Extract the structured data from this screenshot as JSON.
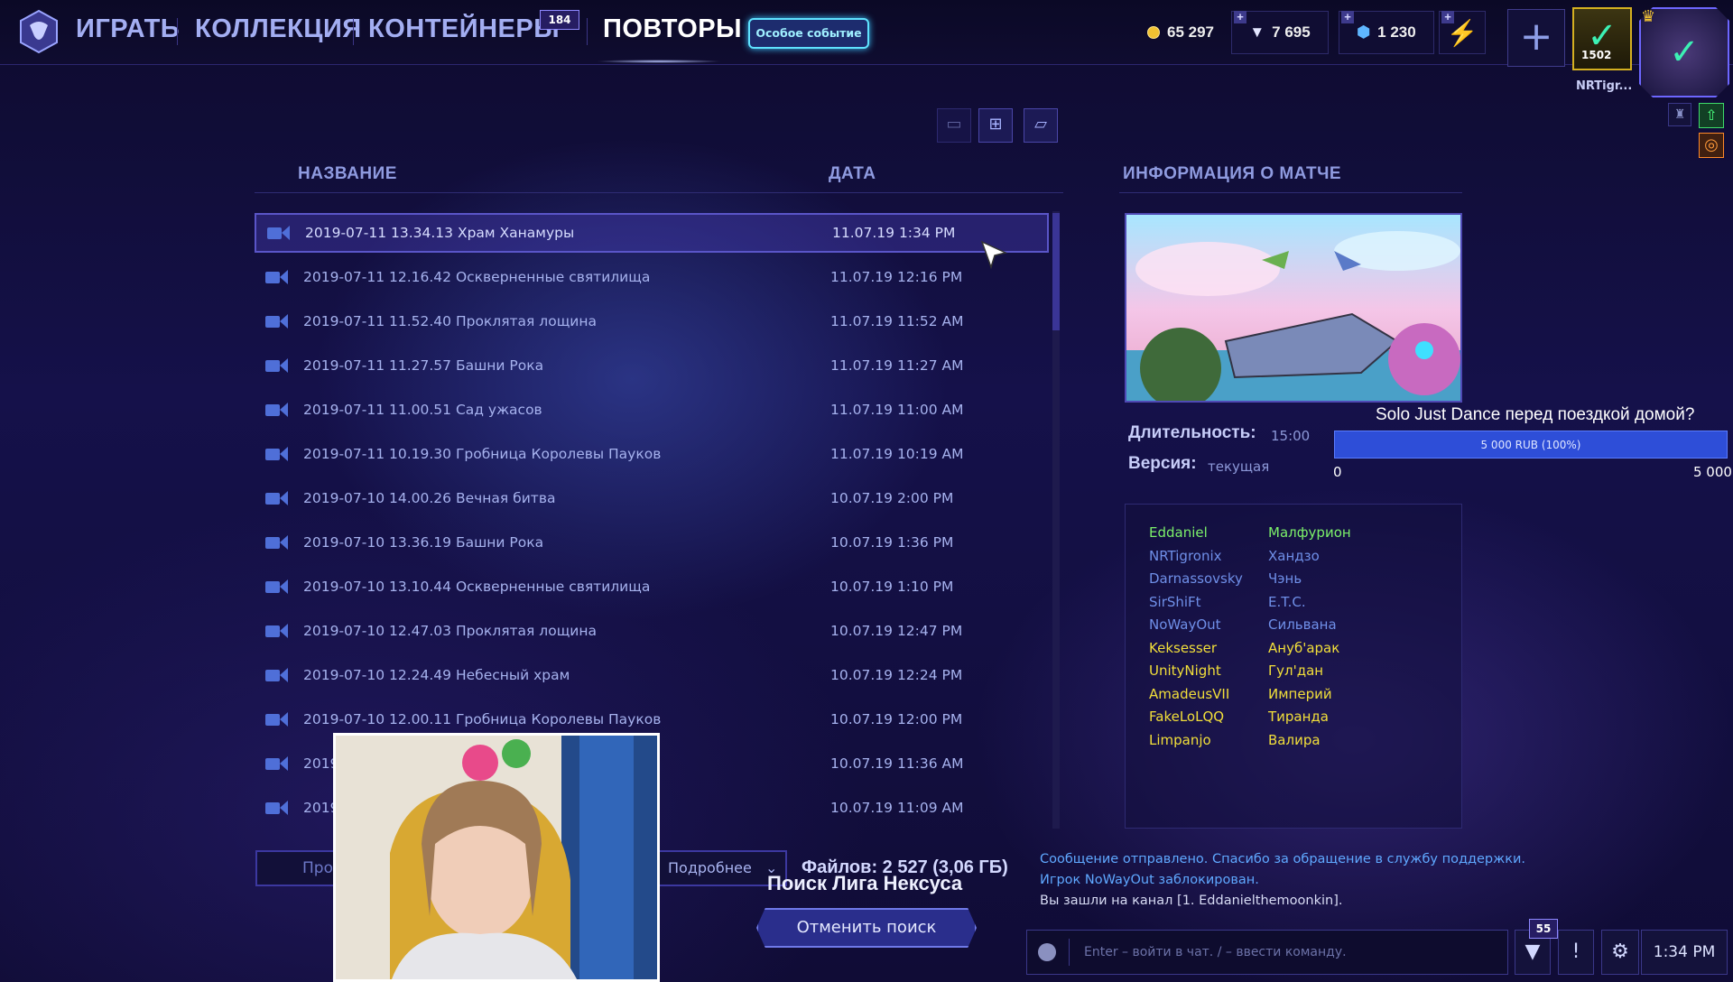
{
  "nav": {
    "play": "ИГРАТЬ",
    "collection": "КОЛЛЕКЦИЯ",
    "containers": "КОНТЕЙНЕРЫ",
    "containers_badge": "184",
    "replays": "ПОВТОРЫ",
    "event": "Особое событие"
  },
  "currency": {
    "gold": "65 297",
    "shards": "7 695",
    "gems": "1 230"
  },
  "profile": {
    "level": "1502",
    "name": "NRTigr..."
  },
  "list": {
    "col_name": "НАЗВАНИЕ",
    "col_date": "ДАТА",
    "rows": [
      {
        "name": "2019-07-11 13.34.13 Храм Ханамуры",
        "date": "11.07.19 1:34 PM"
      },
      {
        "name": "2019-07-11 12.16.42 Оскверненные святилища",
        "date": "11.07.19 12:16 PM"
      },
      {
        "name": "2019-07-11 11.52.40 Проклятая лощина",
        "date": "11.07.19 11:52 AM"
      },
      {
        "name": "2019-07-11 11.27.57 Башни Рока",
        "date": "11.07.19 11:27 AM"
      },
      {
        "name": "2019-07-11 11.00.51 Сад ужасов",
        "date": "11.07.19 11:00 AM"
      },
      {
        "name": "2019-07-11 10.19.30 Гробница Королевы Пауков",
        "date": "11.07.19 10:19 AM"
      },
      {
        "name": "2019-07-10 14.00.26 Вечная битва",
        "date": "10.07.19 2:00 PM"
      },
      {
        "name": "2019-07-10 13.36.19 Башни Рока",
        "date": "10.07.19 1:36 PM"
      },
      {
        "name": "2019-07-10 13.10.44 Оскверненные святилища",
        "date": "10.07.19 1:10 PM"
      },
      {
        "name": "2019-07-10 12.47.03 Проклятая лощина",
        "date": "10.07.19 12:47 PM"
      },
      {
        "name": "2019-07-10 12.24.49 Небесный храм",
        "date": "10.07.19 12:24 PM"
      },
      {
        "name": "2019-07-10 12.00.11 Гробница Королевы Пауков",
        "date": "10.07.19 12:00 PM"
      },
      {
        "name": "2019",
        "date": "10.07.19 11:36 AM"
      },
      {
        "name": "2019",
        "date": "10.07.19 11:09 AM"
      }
    ]
  },
  "match": {
    "header": "ИНФОРМАЦИЯ О МАТЧЕ",
    "duration_label": "Длительность:",
    "duration": "15:00",
    "version_label": "Версия:",
    "version": "текущая",
    "players": [
      {
        "player": "Eddaniel",
        "hero": "Малфурион",
        "color": "#7cf06a"
      },
      {
        "player": "NRTigronix",
        "hero": "Хандзо",
        "color": "#6f8fe8"
      },
      {
        "player": "Darnassovsky",
        "hero": "Чэнь",
        "color": "#6f8fe8"
      },
      {
        "player": "SirShiFt",
        "hero": "E.T.C.",
        "color": "#6f8fe8"
      },
      {
        "player": "NoWayOut",
        "hero": "Сильвана",
        "color": "#6f8fe8"
      },
      {
        "player": "Keksesser",
        "hero": "Ануб'арак",
        "color": "#f2df3a"
      },
      {
        "player": "UnityNight",
        "hero": "Гул'дан",
        "color": "#f2df3a"
      },
      {
        "player": "AmadeusVII",
        "hero": "Империй",
        "color": "#f2df3a"
      },
      {
        "player": "FakeLoLQQ",
        "hero": "Тиранда",
        "color": "#f2df3a"
      },
      {
        "player": "Limpanjo",
        "hero": "Валира",
        "color": "#f2df3a"
      }
    ]
  },
  "donation": {
    "title": "Solo Just Dance перед поездкой домой?",
    "bar": "5 000 RUB (100%)",
    "min": "0",
    "max": "5 000",
    "progress": 1.0
  },
  "footer": {
    "search_placeholder": "Про",
    "more": "Подробнее",
    "files": "Файлов: 2 527 (3,06 ГБ)",
    "queue": "Поиск Лига Нексуса",
    "cancel": "Отменить поиск"
  },
  "chat": {
    "lines": [
      "Сообщение отправлено. Спасибо за обращение в службу поддержки.",
      "Игрок NoWayOut заблокирован.",
      "Вы зашли на канал [1. Eddanielthemoonkin]."
    ],
    "placeholder": "Enter – войти в чат. / – ввести команду.",
    "badge": "55",
    "time": "1:34 PM"
  },
  "colors": {
    "accent": "#5a55c8",
    "event": "#5fe3ff",
    "team_blue": "#6f8fe8",
    "team_yellow": "#f2df3a"
  }
}
